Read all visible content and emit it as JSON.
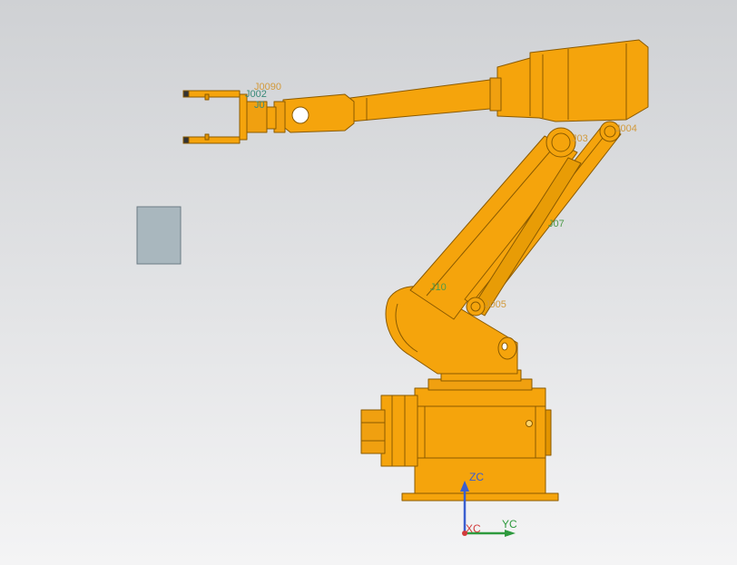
{
  "scene": {
    "colors": {
      "robot": "#f5a40c",
      "robot_dark": "#c07a00",
      "robot_light": "#ffbe3a",
      "block": "#a9b7be",
      "label_orange": "#d29a3c",
      "label_green": "#4f9a4a",
      "axis_x": "#d23b3b",
      "axis_y": "#2e9a3e",
      "axis_z": "#3a5fd0"
    },
    "joint_labels": {
      "j0090": "J0090",
      "j002": "J002",
      "j0_small": "J0",
      "j03": "J03",
      "j004": "J004",
      "j07": "J07",
      "j10": "J10",
      "j005": "J005"
    },
    "triad": {
      "zc": "ZC",
      "xc": "XC",
      "yc": "YC"
    }
  }
}
